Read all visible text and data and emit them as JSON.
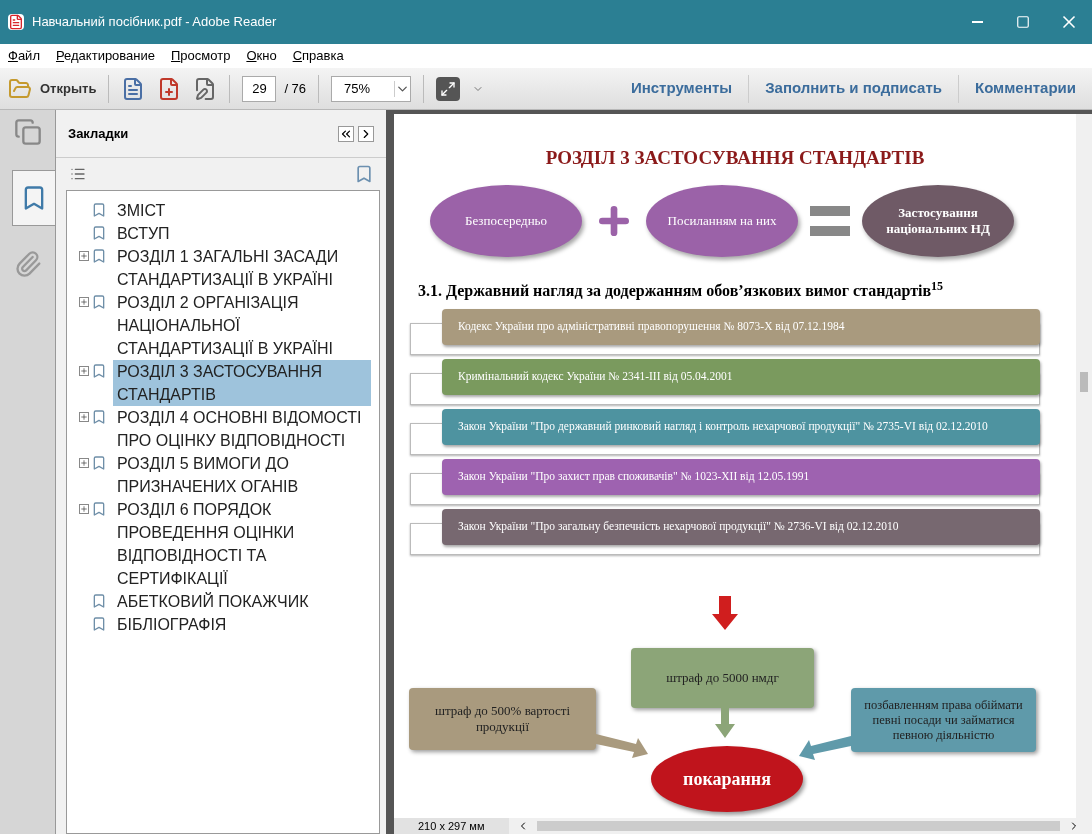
{
  "window": {
    "title": "Навчальний посібник.pdf - Adobe Reader"
  },
  "menu": [
    "Файл",
    "Редактирование",
    "Просмотр",
    "Окно",
    "Справка"
  ],
  "toolbar": {
    "open_label": "Открыть",
    "page_number": "29",
    "page_total": "/ 76",
    "zoom": "75%",
    "links": [
      "Инструменты",
      "Заполнить и подписать",
      "Комментарии"
    ]
  },
  "bookmarks": {
    "title": "Закладки",
    "items": [
      {
        "label": "ЗМІСТ",
        "expandable": false,
        "selected": false
      },
      {
        "label": "ВСТУП",
        "expandable": false,
        "selected": false
      },
      {
        "label": "РОЗДІЛ 1 ЗАГАЛЬНІ ЗАСАДИ СТАНДАРТИЗАЦІЇ В УКРАЇНІ",
        "expandable": true,
        "selected": false
      },
      {
        "label": "РОЗДІЛ 2 ОРГАНІЗАЦІЯ НАЦІОНАЛЬНОЇ СТАНДАРТИЗАЦІЇ В УКРАЇНІ",
        "expandable": true,
        "selected": false
      },
      {
        "label": "РОЗДІЛ 3 ЗАСТОСУВАННЯ СТАНДАРТІВ",
        "expandable": true,
        "selected": true
      },
      {
        "label": "РОЗДІЛ 4 ОСНОВНІ ВІДОМОСТІ ПРО ОЦІНКУ  ВІДПОВІДНОСТІ",
        "expandable": true,
        "selected": false
      },
      {
        "label": "РОЗДІЛ 5 ВИМОГИ ДО ПРИЗНАЧЕНИХ ОГАНІВ",
        "expandable": true,
        "selected": false
      },
      {
        "label": "РОЗДІЛ 6 ПОРЯДОК ПРОВЕДЕННЯ ОЦІНКИ ВІДПОВІДНОСТІ ТА СЕРТИФІКАЦІЇ",
        "expandable": true,
        "selected": false
      },
      {
        "label": "АБЕТКОВИЙ ПОКАЖЧИК",
        "expandable": false,
        "selected": false
      },
      {
        "label": "БІБЛІОГРАФІЯ",
        "expandable": false,
        "selected": false
      }
    ]
  },
  "document": {
    "heading": "РОЗДІЛ 3 ЗАСТОСУВАННЯ СТАНДАРТІВ",
    "equation": [
      {
        "text": "Безпосередньо",
        "color": "#9b62a8"
      },
      {
        "text": "Посиланням на них",
        "color": "#9b62a8"
      },
      {
        "text": "Застосування національних НД",
        "color": "#6f5a66"
      }
    ],
    "section_heading": "3.1. Державний нагляд за додержанням обов’язкових вимог стандартів$^{15}$",
    "laws": [
      {
        "text": "Кодекс України про адміністративні правопорушення № 8073-X від 07.12.1984",
        "color": "#a99a7e"
      },
      {
        "text": "Кримінальний кодекс України № 2341-ІІІ від 05.04.2001",
        "color": "#7a9a5e"
      },
      {
        "text": "Закон України \"Про державний ринковий нагляд і контроль нехарчової продукції\" № 2735-VI від 02.12.2010",
        "color": "#4e93a0"
      },
      {
        "text": "Закон України \"Про захист прав споживачів\" № 1023-XII від 12.05.1991",
        "color": "#9e62b0"
      },
      {
        "text": "Закон України \"Про загальну безпечність нехарчової продукції\" № 2736-VI від 02.12.2010",
        "color": "#776870"
      }
    ],
    "penalties": [
      {
        "text": "штраф до 5000 нмдг",
        "color": "#8ca578"
      },
      {
        "text": "штраф до 500% вартості продукції",
        "color": "#a99a7e"
      },
      {
        "text": "позбавленням права обіймати певні посади чи займатися певною діяльністю",
        "color": "#5f9aaa"
      }
    ],
    "result": "покарання"
  },
  "status": {
    "page_size": "210 x 297 мм"
  }
}
